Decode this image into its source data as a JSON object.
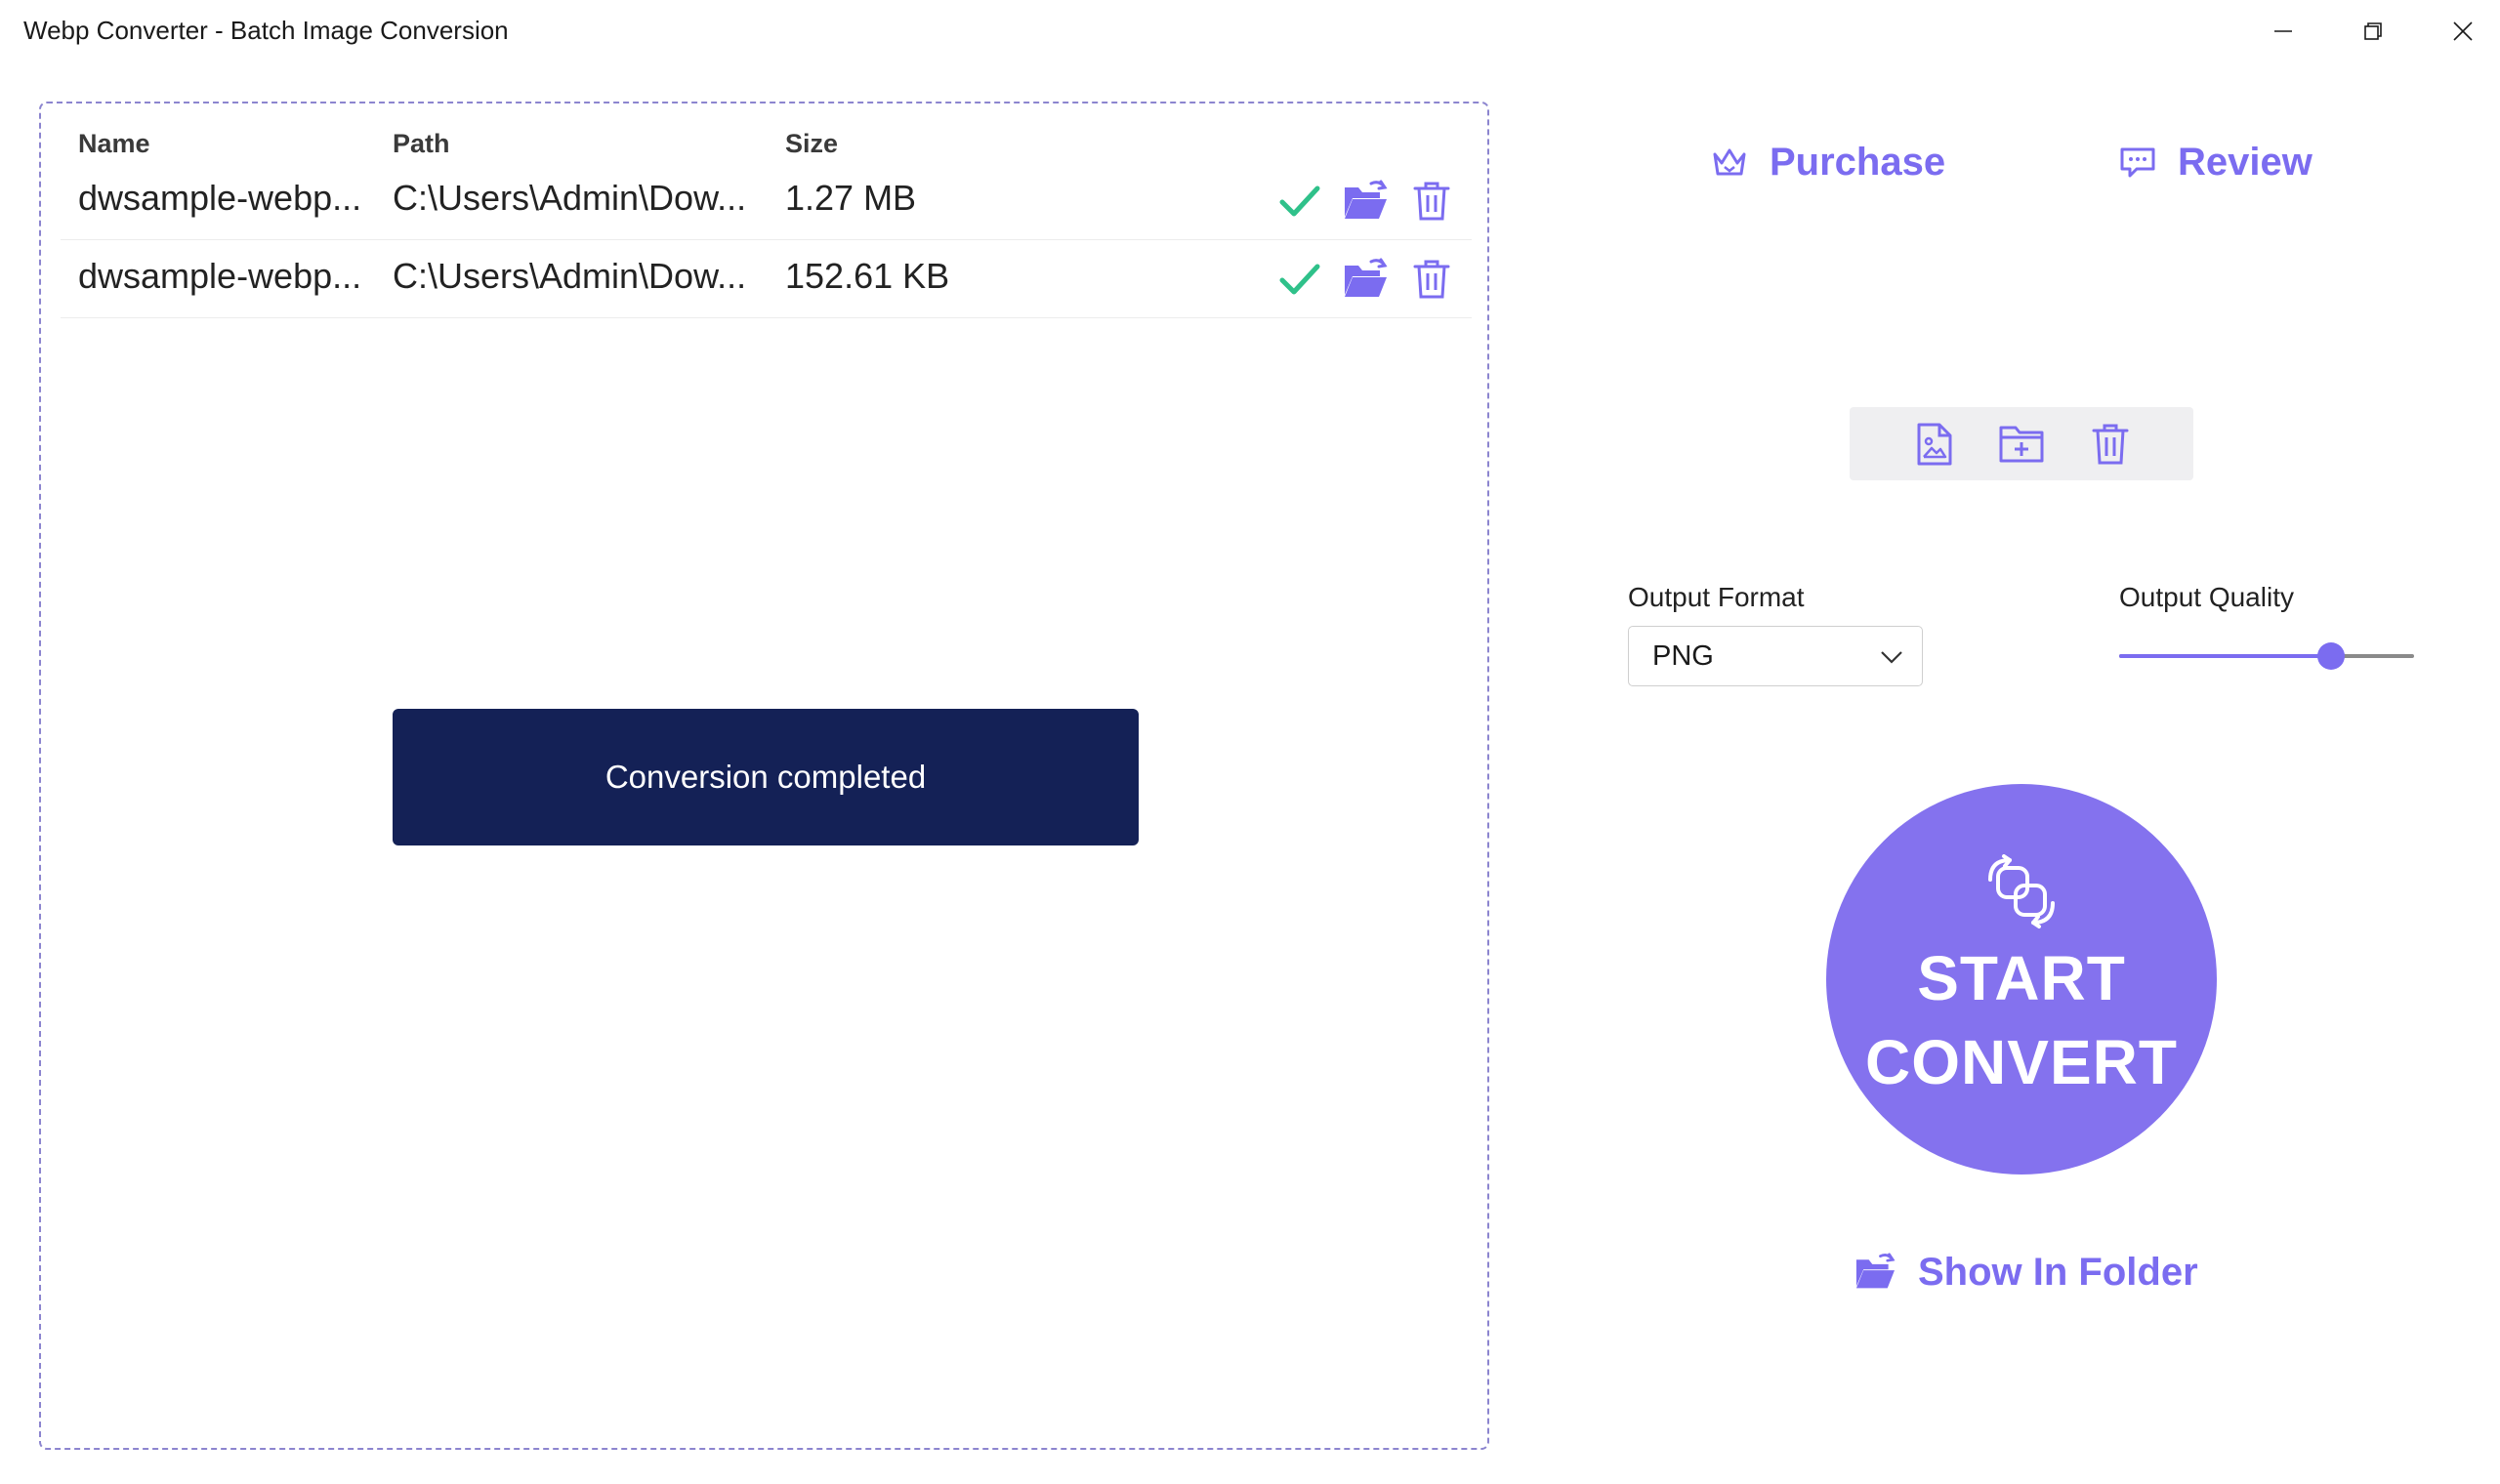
{
  "window": {
    "title": "Webp Converter - Batch Image Conversion"
  },
  "file_list": {
    "columns": {
      "name": "Name",
      "path": "Path",
      "size": "Size"
    },
    "rows": [
      {
        "name": "dwsample-webp...",
        "path": "C:\\Users\\Admin\\Dow...",
        "size": "1.27 MB",
        "status": "check-icon"
      },
      {
        "name": "dwsample-webp...",
        "path": "C:\\Users\\Admin\\Dow...",
        "size": "152.61 KB",
        "status": "check-icon"
      }
    ]
  },
  "toast": {
    "message": "Conversion completed"
  },
  "header_links": {
    "purchase": "Purchase",
    "review": "Review"
  },
  "output": {
    "format_label": "Output Format",
    "format_value": "PNG",
    "quality_label": "Output Quality",
    "quality_fraction": 0.72
  },
  "convert_button": {
    "line1": "START",
    "line2": "CONVERT"
  },
  "show_in_folder": "Show In Folder",
  "colors": {
    "accent": "#7b6cf0",
    "convert_bg": "#8472ee",
    "toast_bg": "#142156",
    "success": "#2fc18a",
    "border_dashed": "#8c85cf"
  }
}
